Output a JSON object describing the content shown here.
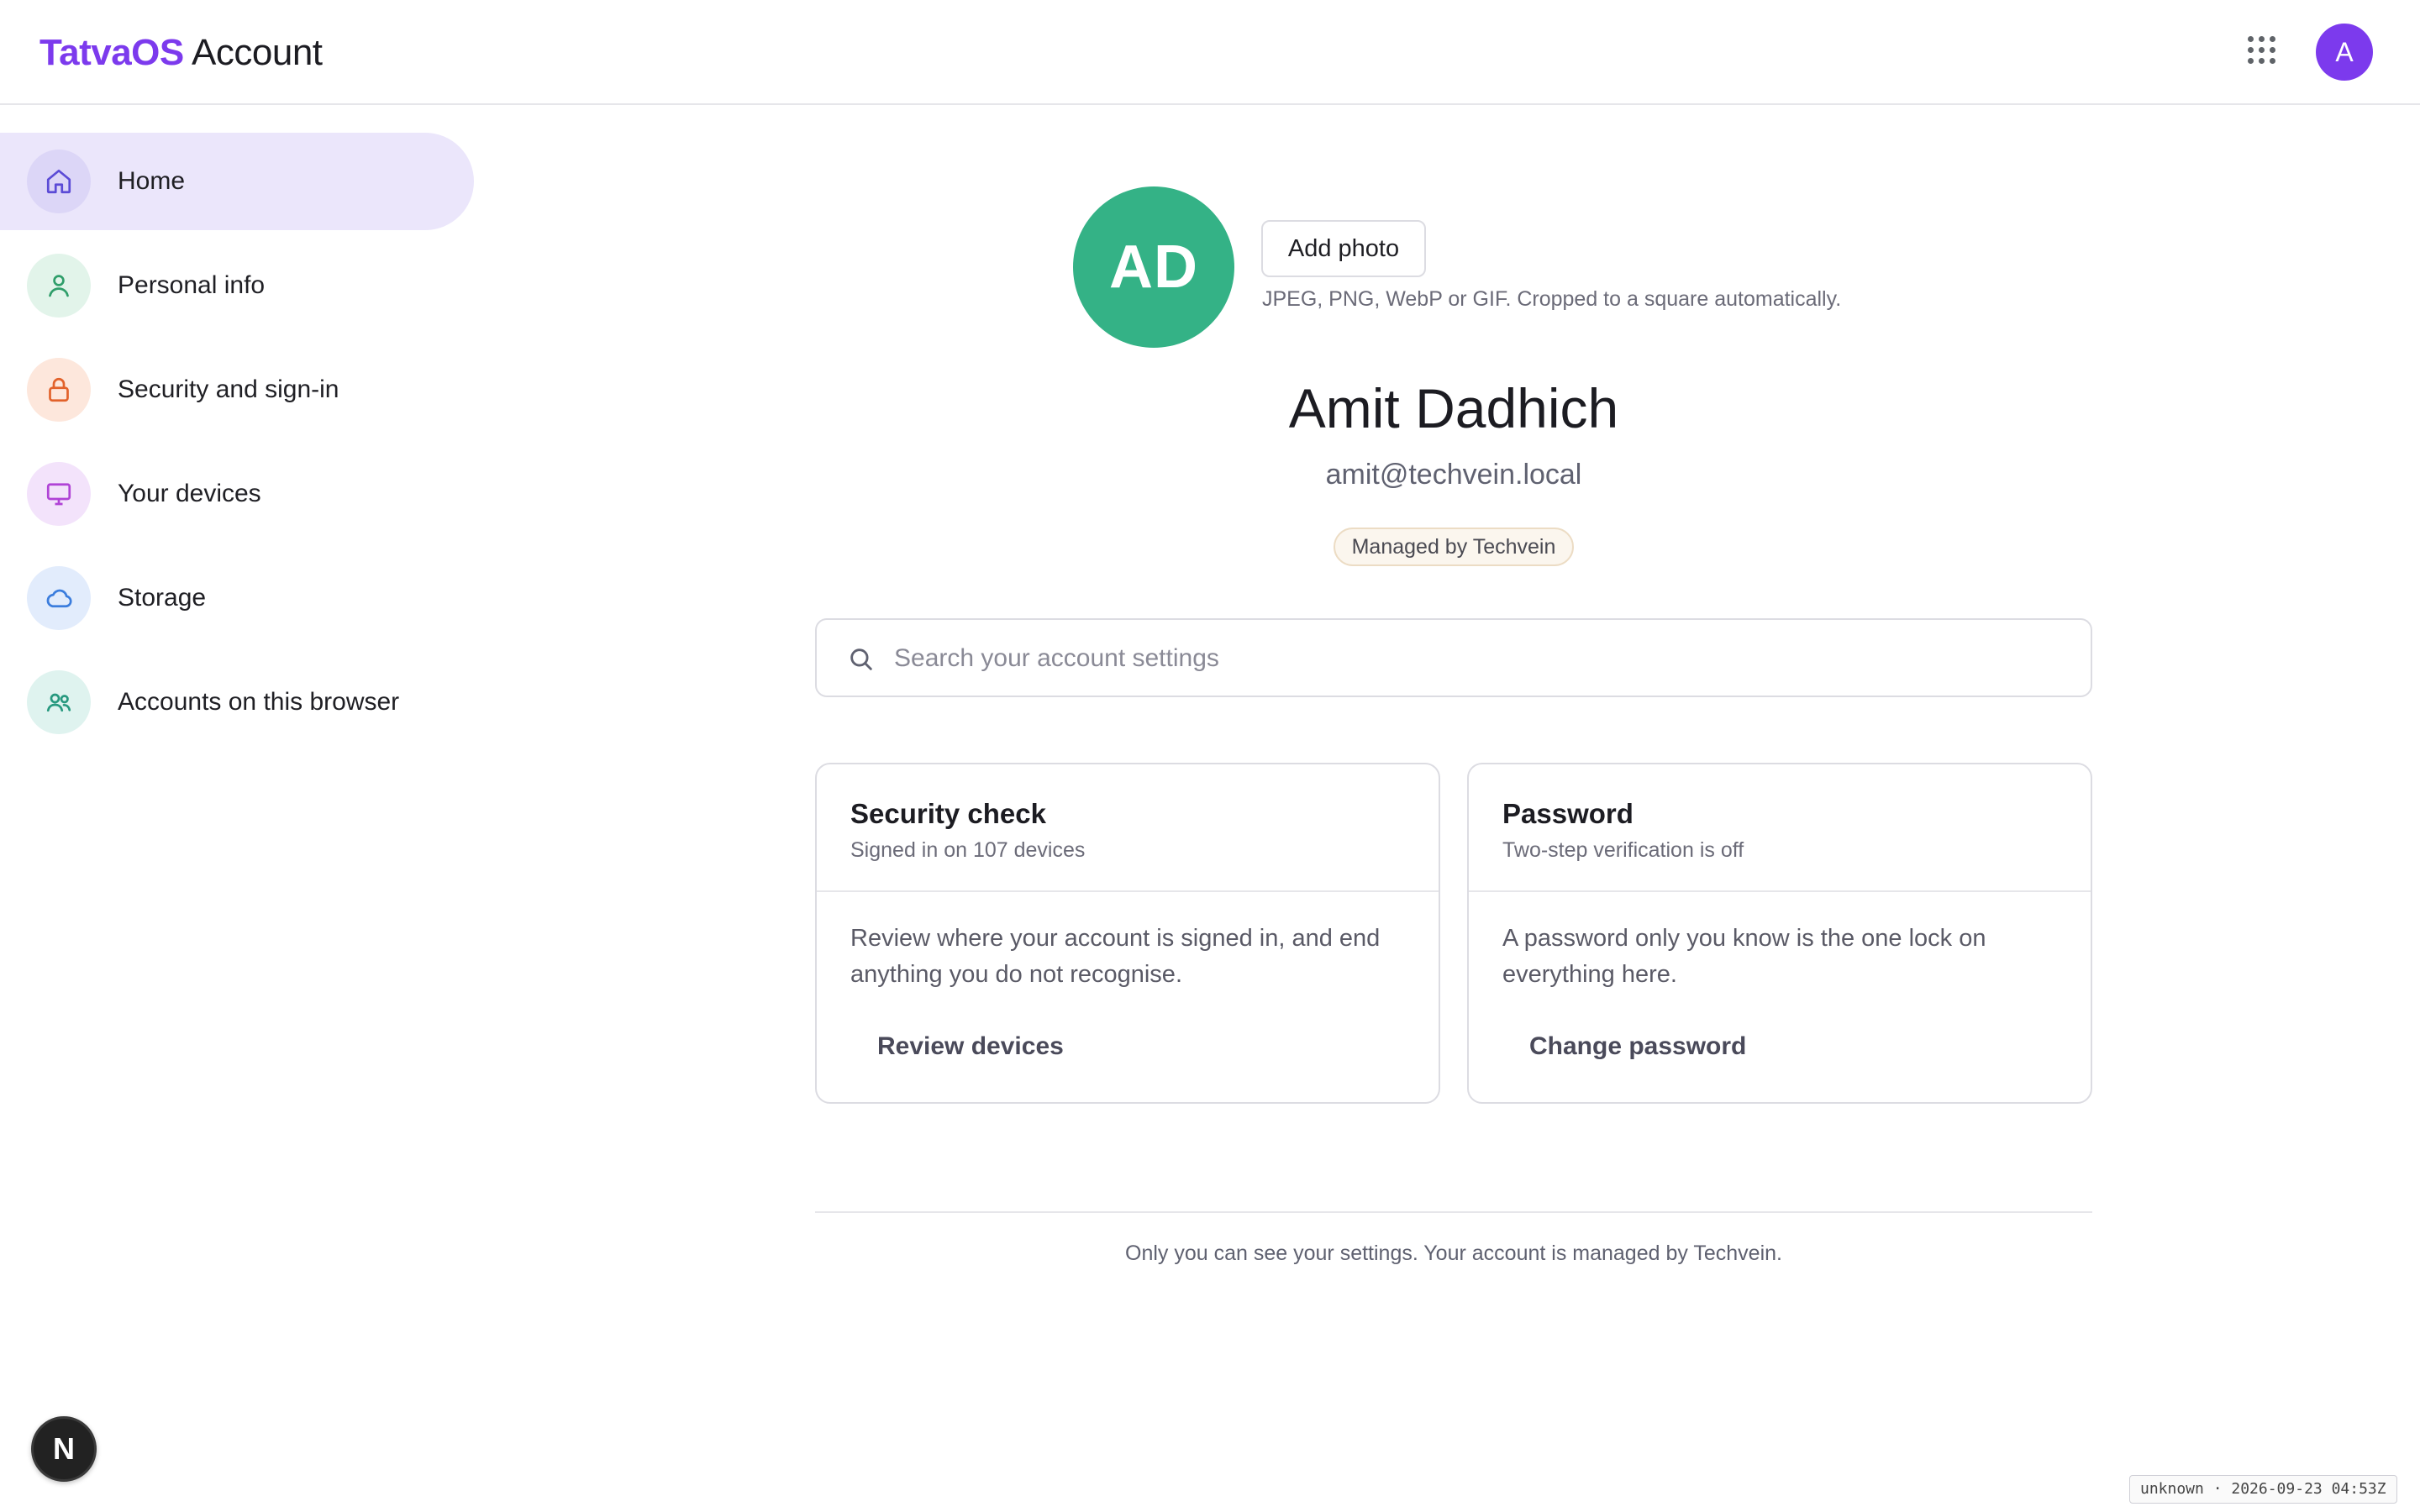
{
  "app": {
    "brand_os": "TatvaOS",
    "brand_rest": " Account",
    "brand_color": "#7c3aed",
    "avatar_initial": "A"
  },
  "sidebar": {
    "items": [
      {
        "label": "Home",
        "icon": "home-icon",
        "active": true,
        "icon_bg": "#dcd6f7",
        "icon_color": "#5b4bd6"
      },
      {
        "label": "Personal info",
        "icon": "person-icon",
        "active": false,
        "icon_bg": "#e2f4ea",
        "icon_color": "#2f9e6a"
      },
      {
        "label": "Security and sign-in",
        "icon": "lock-icon",
        "active": false,
        "icon_bg": "#fde7dc",
        "icon_color": "#e2622b"
      },
      {
        "label": "Your devices",
        "icon": "monitor-icon",
        "active": false,
        "icon_bg": "#f3e3fb",
        "icon_color": "#b043d6"
      },
      {
        "label": "Storage",
        "icon": "cloud-icon",
        "active": false,
        "icon_bg": "#e2ecfc",
        "icon_color": "#3b7ddd"
      },
      {
        "label": "Accounts on this browser",
        "icon": "people-icon",
        "active": false,
        "icon_bg": "#dff3ef",
        "icon_color": "#27997f"
      }
    ]
  },
  "profile": {
    "initials": "AD",
    "avatar_color": "#34b286",
    "add_photo_label": "Add photo",
    "photo_hint": "JPEG, PNG, WebP or GIF. Cropped to a square automatically.",
    "name": "Amit Dadhich",
    "email": "amit@techvein.local",
    "managed_badge": "Managed by Techvein"
  },
  "search": {
    "placeholder": "Search your account settings",
    "value": ""
  },
  "cards": [
    {
      "title": "Security check",
      "subtitle": "Signed in on 107 devices",
      "body": "Review where your account is signed in, and end anything you do not recognise.",
      "action": "Review devices"
    },
    {
      "title": "Password",
      "subtitle": "Two-step verification is off",
      "body": "A password only you know is the one lock on everything here.",
      "action": "Change password"
    }
  ],
  "footer": {
    "note": "Only you can see your settings. Your account is managed by Techvein."
  },
  "dev_badge": {
    "letter": "N"
  },
  "stamp": {
    "text": "unknown · 2026-09-23 04:53Z"
  }
}
